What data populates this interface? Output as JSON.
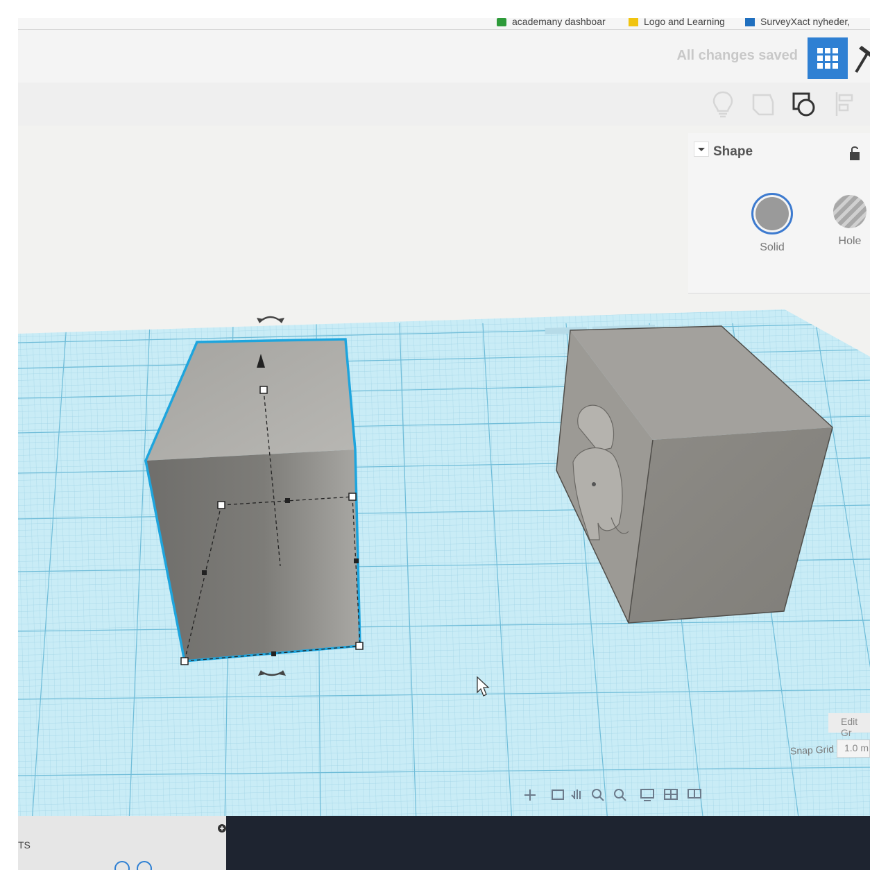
{
  "bookmarks": [
    {
      "label": "academany dashboar",
      "color": "#2e9b3a"
    },
    {
      "label": "Logo and Learning",
      "color": "#f1c40f"
    },
    {
      "label": "SurveyXact nyheder,",
      "color": "#1f6fbf"
    }
  ],
  "header": {
    "saved_status": "All changes saved"
  },
  "icons": [
    "lightbulb-icon",
    "note-icon",
    "group-shapes-icon",
    "align-icon"
  ],
  "inspector": {
    "title": "Shape",
    "options": [
      {
        "label": "Solid",
        "color": "#9a9a9a",
        "selected": true
      },
      {
        "label": "Hole",
        "color": "#a8a8a8",
        "selected": false
      }
    ]
  },
  "grid": {
    "edit_label": "Edit Gr",
    "snap_label": "Snap Grid",
    "snap_value": "1.0 m"
  },
  "taskbar": {
    "label": "TS"
  },
  "colors": {
    "accent": "#2f80d3",
    "workplane": "#bfe8f4",
    "selection": "#1ea5dd",
    "shape": "#8e8c87"
  }
}
